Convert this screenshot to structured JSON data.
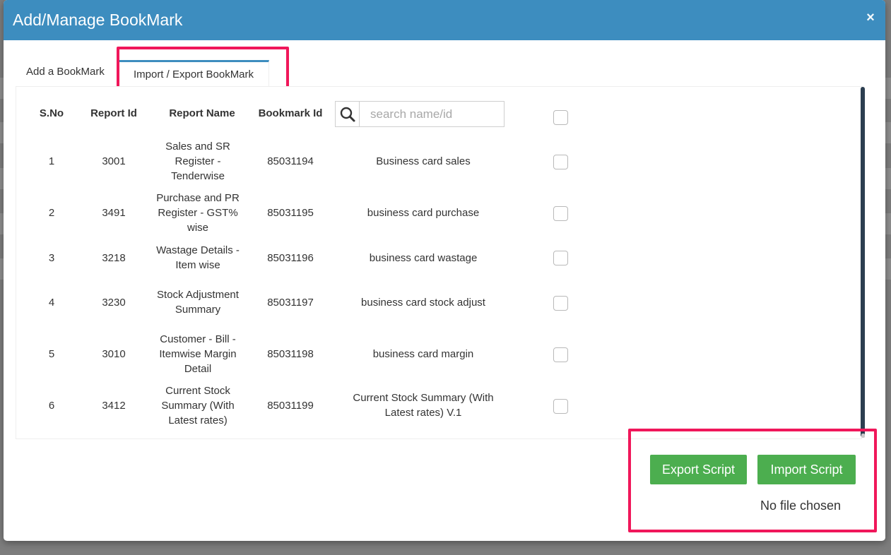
{
  "modal": {
    "title": "Add/Manage BookMark",
    "close_label": "×"
  },
  "tabs": [
    {
      "label": "Add a BookMark",
      "active": false
    },
    {
      "label": "Import / Export BookMark",
      "active": true
    }
  ],
  "table": {
    "headers": [
      "S.No",
      "Report Id",
      "Report Name",
      "Bookmark Id"
    ],
    "search_placeholder": "search name/id",
    "rows": [
      {
        "sno": "1",
        "report_id": "3001",
        "report_name": "Sales and SR Register - Tenderwise",
        "bookmark_id": "85031194",
        "bookmark_name": "Business card sales"
      },
      {
        "sno": "2",
        "report_id": "3491",
        "report_name": "Purchase and PR Register - GST% wise",
        "bookmark_id": "85031195",
        "bookmark_name": "business card purchase"
      },
      {
        "sno": "3",
        "report_id": "3218",
        "report_name": "Wastage Details - Item wise",
        "bookmark_id": "85031196",
        "bookmark_name": "business card wastage"
      },
      {
        "sno": "4",
        "report_id": "3230",
        "report_name": "Stock Adjustment Summary",
        "bookmark_id": "85031197",
        "bookmark_name": "business card stock adjust"
      },
      {
        "sno": "5",
        "report_id": "3010",
        "report_name": "Customer - Bill - Itemwise Margin Detail",
        "bookmark_id": "85031198",
        "bookmark_name": "business card margin"
      },
      {
        "sno": "6",
        "report_id": "3412",
        "report_name": "Current Stock Summary (With Latest rates)",
        "bookmark_id": "85031199",
        "bookmark_name": "Current Stock Summary (With Latest rates) V.1"
      }
    ]
  },
  "actions": {
    "export_label": "Export Script",
    "import_label": "Import Script",
    "file_status": "No file chosen"
  },
  "colors": {
    "header_bg": "#3d8dbf",
    "button_green": "#4cae4f",
    "highlight": "#f0175a"
  }
}
